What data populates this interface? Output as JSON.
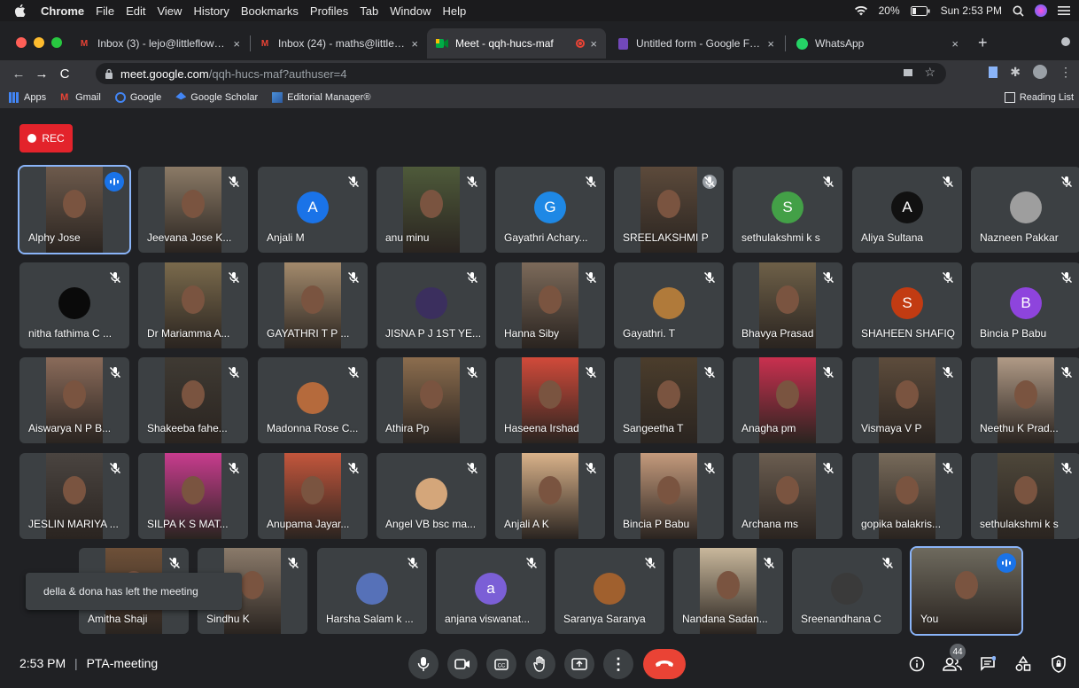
{
  "menubar": {
    "app": "Chrome",
    "items": [
      "File",
      "Edit",
      "View",
      "History",
      "Bookmarks",
      "Profiles",
      "Tab",
      "Window",
      "Help"
    ],
    "battery": "20%",
    "datetime": "Sun 2:53 PM"
  },
  "tabs": [
    {
      "title": "Inbox (3) - lejo@littleflowercoll",
      "icon": "gmail-icon",
      "color": "#ea4335"
    },
    {
      "title": "Inbox (24) - maths@littleflower",
      "icon": "gmail-icon",
      "color": "#ea4335"
    },
    {
      "title": "Meet - qqh-hucs-maf",
      "icon": "meet-icon",
      "color": "#00897b"
    },
    {
      "title": "Untitled form - Google Forms",
      "icon": "forms-icon",
      "color": "#7248b9"
    },
    {
      "title": "WhatsApp",
      "icon": "whatsapp-icon",
      "color": "#25d366"
    }
  ],
  "address": {
    "domain": "meet.google.com",
    "path": "/qqh-hucs-maf?authuser=4"
  },
  "bookmarks": [
    {
      "label": "Apps",
      "icon": "apps-grid-icon"
    },
    {
      "label": "Gmail",
      "icon": "gmail-icon"
    },
    {
      "label": "Google",
      "icon": "google-icon"
    },
    {
      "label": "Google Scholar",
      "icon": "scholar-icon"
    },
    {
      "label": "Editorial Manager®",
      "icon": "editorial-icon"
    }
  ],
  "reading_list": "Reading List",
  "rec_label": "REC",
  "participants": [
    {
      "name": "Alphy Jose",
      "kind": "video",
      "tone": "#6d5a4c",
      "speaking": true
    },
    {
      "name": "Jeevana Jose K...",
      "kind": "video",
      "tone": "#8b7a66"
    },
    {
      "name": "Anjali M",
      "kind": "avatar",
      "letter": "A",
      "color": "#1a73e8"
    },
    {
      "name": "anu minu",
      "kind": "video",
      "tone": "#4e5a3a"
    },
    {
      "name": "Gayathri Achary...",
      "kind": "avatar",
      "letter": "G",
      "color": "#1e88e5"
    },
    {
      "name": "SREELAKSHMI P",
      "kind": "video",
      "tone": "#5c4a3b",
      "muted_icon_grey": true
    },
    {
      "name": "sethulakshmi k s",
      "kind": "avatar",
      "letter": "S",
      "color": "#43a047"
    },
    {
      "name": "Aliya Sultana",
      "kind": "avatar",
      "letter": "A",
      "color": "#111111"
    },
    {
      "name": "Nazneen Pakkar",
      "kind": "photo",
      "color": "#9e9e9e"
    },
    {
      "name": "nitha fathima C ...",
      "kind": "photo",
      "color": "#0a0a0a"
    },
    {
      "name": "Dr Mariamma A...",
      "kind": "video",
      "tone": "#7a6a4c"
    },
    {
      "name": "GAYATHRI T P ...",
      "kind": "video",
      "tone": "#a38a6c"
    },
    {
      "name": "JISNA P J 1ST YE...",
      "kind": "photo",
      "color": "#3b2f5e"
    },
    {
      "name": "Hanna Siby",
      "kind": "video",
      "tone": "#7c6a5a"
    },
    {
      "name": "Gayathri. T",
      "kind": "photo",
      "color": "#b07a3a"
    },
    {
      "name": "Bhavya Prasad",
      "kind": "video",
      "tone": "#6e6048"
    },
    {
      "name": "SHAHEEN SHAFIQ",
      "kind": "photo",
      "color": "#c23b12",
      "letter": "S"
    },
    {
      "name": "Bincia P Babu",
      "kind": "avatar",
      "letter": "B",
      "color": "#8e44dd"
    },
    {
      "name": "Aiswarya N P B...",
      "kind": "video",
      "tone": "#8a6b5a"
    },
    {
      "name": "Shakeeba fahe...",
      "kind": "video",
      "tone": "#3f3a33"
    },
    {
      "name": "Madonna Rose C...",
      "kind": "photo",
      "color": "#b56a3c"
    },
    {
      "name": "Athira Pp",
      "kind": "video",
      "tone": "#8c6d4e"
    },
    {
      "name": "Haseena Irshad",
      "kind": "video",
      "tone": "#d14a3a"
    },
    {
      "name": "Sangeetha T",
      "kind": "video",
      "tone": "#4b3d2c"
    },
    {
      "name": "Anagha pm",
      "kind": "video",
      "tone": "#c9304f"
    },
    {
      "name": "Vismaya V P",
      "kind": "video",
      "tone": "#5d4c3c"
    },
    {
      "name": "Neethu K Prad...",
      "kind": "video",
      "tone": "#b09a86"
    },
    {
      "name": "JESLIN MARIYA ...",
      "kind": "video",
      "tone": "#4a4440"
    },
    {
      "name": "SILPA K S MAT...",
      "kind": "video",
      "tone": "#c83c8e"
    },
    {
      "name": "Anupama Jayar...",
      "kind": "video",
      "tone": "#c3563c"
    },
    {
      "name": "Angel VB bsc ma...",
      "kind": "photo",
      "color": "#d4a67a"
    },
    {
      "name": "Anjali A K",
      "kind": "video",
      "tone": "#d9b28a"
    },
    {
      "name": "Bincia P Babu",
      "kind": "video",
      "tone": "#c49a7c"
    },
    {
      "name": "Archana ms",
      "kind": "video",
      "tone": "#6b5d50"
    },
    {
      "name": "gopika balakris...",
      "kind": "video",
      "tone": "#776a5a"
    },
    {
      "name": "sethulakshmi k s",
      "kind": "video",
      "tone": "#4e473a"
    },
    {
      "name": "Amitha Shaji",
      "kind": "video",
      "tone": "#6e5038"
    },
    {
      "name": "Sindhu K",
      "kind": "video",
      "tone": "#8a7a6a"
    },
    {
      "name": "Harsha Salam k ...",
      "kind": "photo",
      "color": "#5671b8"
    },
    {
      "name": "anjana viswanat...",
      "kind": "avatar",
      "letter": "a",
      "color": "#7b5fd6"
    },
    {
      "name": "Saranya Saranya",
      "kind": "photo",
      "color": "#a0602e"
    },
    {
      "name": "Nandana Sadan...",
      "kind": "video",
      "tone": "#c9b89c"
    },
    {
      "name": "Sreenandhana C",
      "kind": "photo",
      "color": "#3a3a3a"
    },
    {
      "name": "You",
      "kind": "video",
      "tone": "#6e6a5e",
      "speaking": true,
      "self": true
    }
  ],
  "toast": "della & dona has left the meeting",
  "bottom": {
    "time": "2:53 PM",
    "meeting": "PTA-meeting",
    "people_count": "44"
  }
}
